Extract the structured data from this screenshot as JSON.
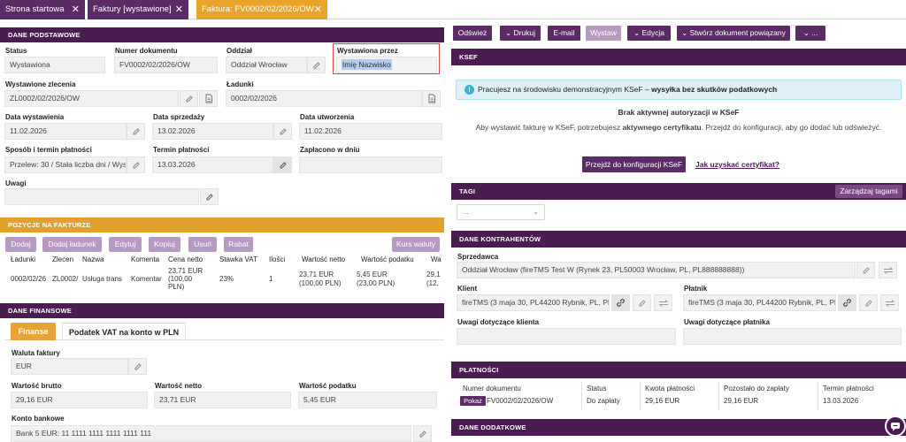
{
  "tabs": [
    {
      "label": "Strona startowa"
    },
    {
      "label": "Faktury [wystawione]"
    },
    {
      "label": "Faktura: FV0002/02/2026/OW"
    }
  ],
  "basic": {
    "title": "DANE PODSTAWOWE",
    "status_label": "Status",
    "status": "Wystawiona",
    "docnum_label": "Numer dokumentu",
    "docnum": "FV0002/02/2026/OW",
    "branch_label": "Oddział",
    "branch": "Oddział Wrocław",
    "issued_by_label": "Wystawiona przez",
    "issued_by": "Imię Nazwisko",
    "order_label": "Wystawione zlecenia",
    "order": "ZL0002/02/2026/OW",
    "loads_label": "Ładunki",
    "loads": "0002/02/2026",
    "issue_date_label": "Data wystawienia",
    "issue_date": "11.02.2026",
    "sale_date_label": "Data sprzedaży",
    "sale_date": "13.02.2026",
    "created_label": "Data utworzenia",
    "created": "11.02.2026",
    "payment_label": "Sposób i termin płatności",
    "payment": "Przelew: 30 / Stała liczba dni / Wys",
    "due_label": "Termin płatności",
    "due": "13.03.2026",
    "paid_label": "Zapłacono w dniu",
    "paid": "",
    "notes_label": "Uwagi",
    "notes": ""
  },
  "items": {
    "title": "POZYCJE NA FAKTURZE",
    "buttons": [
      "Dodaj",
      "Dodaj ładunek",
      "Edytuj",
      "Kopiuj",
      "Usuń",
      "Rabat"
    ],
    "fx_button": "Kurs waluty",
    "headers": [
      "Ładunki",
      "Zlecen",
      "Nazwa",
      "Komenta",
      "Cena netto",
      "Stawka VAT",
      "Ilości",
      "Wartość netto",
      "Wartość podatku",
      "Wa"
    ],
    "row": {
      "loads": "0002/02/26",
      "order": "ZL0002/",
      "name": "Usługa trans",
      "comment": "Komentar",
      "price_1": "23,71 EUR",
      "price_2": "(100,00",
      "price_3": "PLN)",
      "vat": "23%",
      "qty": "1",
      "net_1": "23,71 EUR",
      "net_2": "(100,00 PLN)",
      "tax_1": "5,45 EUR",
      "tax_2": "(23,00 PLN)",
      "gross_1": "29,1",
      "gross_2": "(12,"
    }
  },
  "finance": {
    "title": "DANE FINANSOWE",
    "tab_active": "Finanse",
    "tab_other": "Podatek VAT na konto w PLN",
    "currency_label": "Waluta faktury",
    "currency": "EUR",
    "gross_label": "Wartość brutto",
    "gross": "29,16 EUR",
    "net_label": "Wartość netto",
    "net": "23,71 EUR",
    "tax_label": "Wartość podatku",
    "tax": "5,45 EUR",
    "bank_label": "Konto bankowe",
    "bank": "Bank 5 EUR: 11 1111 1111 1111 1111 111"
  },
  "toolbar": {
    "refresh": "Odśwież",
    "print": "Drukuj",
    "email": "E-mail",
    "issue": "Wystaw",
    "edit": "Edycja",
    "create_related": "Stwórz dokument powiązany",
    "more": "..."
  },
  "ksef": {
    "title": "KSEF",
    "info_normal": "Pracujesz na środowisku demonstracyjnym KSeF – ",
    "info_bold": "wysyłka bez skutków podatkowych",
    "no_auth": "Brak aktywnej autoryzacji w KSeF",
    "desc_1": "Aby wystawić fakturę w KSeF, potrzebujesz ",
    "desc_bold": "aktywnego certyfikatu",
    "desc_2": ". Przejdź do konfiguracji, aby go dodać lub odświeżyć.",
    "config_button": "Przejdź do konfiguracji KSeF",
    "cert_link": "Jak uzyskać certyfikat?"
  },
  "tags": {
    "title": "TAGI",
    "manage": "Zarządzaj tagami",
    "select": "..."
  },
  "contractors": {
    "title": "DANE KONTRAHENTÓW",
    "seller_label": "Sprzedawca",
    "seller": "Oddział Wrocław (fireTMS Test W (Rynek 23, PL50003 Wrocław, PL, PL888888888))",
    "client_label": "Klient",
    "client": "fireTMS (3 maja 30, PL44200 Rybnik, PL, PL12",
    "payer_label": "Płatnik",
    "payer": "fireTMS (3 maja 30, PL44200 Rybnik, PL, PL12",
    "client_notes_label": "Uwagi dotyczące klienta",
    "payer_notes_label": "Uwagi dotyczące płatnika"
  },
  "payments": {
    "title": "PŁATNOŚCI",
    "headers": [
      "Numer dokumentu",
      "Status",
      "Kwota płatności",
      "Pozostało do zapłaty",
      "Termin płatności"
    ],
    "show": "Pokaż",
    "doc": "FV0002/02/2026/OW",
    "status": "Do zapłaty",
    "amount": "29,16 EUR",
    "remaining": "29,16 EUR",
    "due": "13.03.2026"
  },
  "extra": {
    "title": "DANE DODATKOWE"
  },
  "colors": {
    "purple": "#5b2b66",
    "header": "#4a1c52",
    "orange": "#e2a12c",
    "light_purple": "#b79ac1"
  }
}
